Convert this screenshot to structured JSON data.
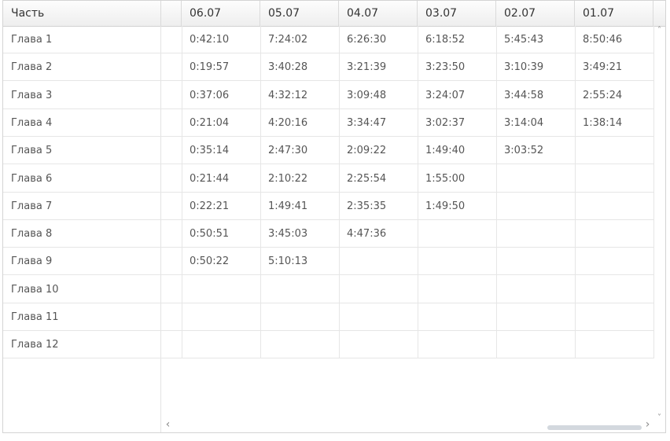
{
  "header": {
    "part_label": "Часть",
    "dates": [
      "06.07",
      "05.07",
      "04.07",
      "03.07",
      "02.07",
      "01.07"
    ]
  },
  "rows": [
    {
      "label": "Глава 1",
      "values": [
        "0:42:10",
        "7:24:02",
        "6:26:30",
        "6:18:52",
        "5:45:43",
        "8:50:46"
      ]
    },
    {
      "label": "Глава 2",
      "values": [
        "0:19:57",
        "3:40:28",
        "3:21:39",
        "3:23:50",
        "3:10:39",
        "3:49:21"
      ]
    },
    {
      "label": "Глава 3",
      "values": [
        "0:37:06",
        "4:32:12",
        "3:09:48",
        "3:24:07",
        "3:44:58",
        "2:55:24"
      ]
    },
    {
      "label": "Глава 4",
      "values": [
        "0:21:04",
        "4:20:16",
        "3:34:47",
        "3:02:37",
        "3:14:04",
        "1:38:14"
      ]
    },
    {
      "label": "Глава 5",
      "values": [
        "0:35:14",
        "2:47:30",
        "2:09:22",
        "1:49:40",
        "3:03:52",
        ""
      ]
    },
    {
      "label": "Глава 6",
      "values": [
        "0:21:44",
        "2:10:22",
        "2:25:54",
        "1:55:00",
        "",
        ""
      ]
    },
    {
      "label": "Глава 7",
      "values": [
        "0:22:21",
        "1:49:41",
        "2:35:35",
        "1:49:50",
        "",
        ""
      ]
    },
    {
      "label": "Глава 8",
      "values": [
        "0:50:51",
        "3:45:03",
        "4:47:36",
        "",
        "",
        ""
      ]
    },
    {
      "label": "Глава 9",
      "values": [
        "0:50:22",
        "5:10:13",
        "",
        "",
        "",
        ""
      ]
    },
    {
      "label": "Глава 10",
      "values": [
        "",
        "",
        "",
        "",
        "",
        ""
      ]
    },
    {
      "label": "Глава 11",
      "values": [
        "",
        "",
        "",
        "",
        "",
        ""
      ]
    },
    {
      "label": "Глава 12",
      "values": [
        "",
        "",
        "",
        "",
        "",
        ""
      ]
    }
  ],
  "scroll": {
    "up": "˄",
    "down": "˅",
    "left": "‹",
    "right": "›"
  }
}
